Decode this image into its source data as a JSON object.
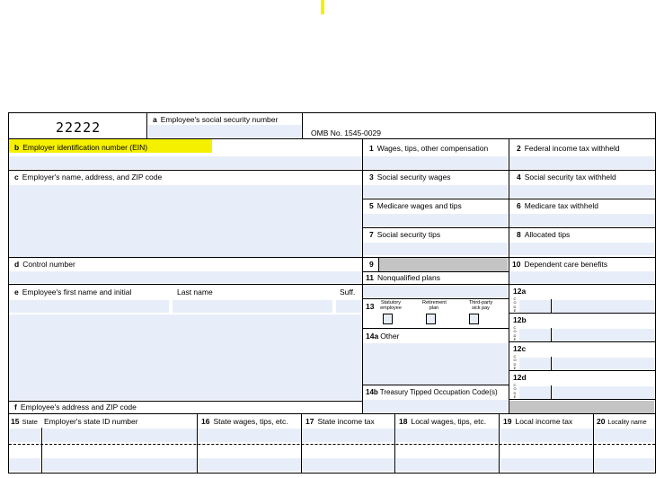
{
  "form": {
    "code": "22222",
    "omb": "OMB No. 1545-0029",
    "highlight_color": "#f5f000"
  },
  "boxes": {
    "a": {
      "letter": "a",
      "label": "Employee's social security number"
    },
    "b": {
      "letter": "b",
      "label": "Employer identification number (EIN)"
    },
    "c": {
      "letter": "c",
      "label": "Employer's name, address, and ZIP code"
    },
    "d": {
      "letter": "d",
      "label": "Control number"
    },
    "e": {
      "letter": "e",
      "label": "Employee's first name and initial",
      "last": "Last name",
      "suff": "Suff."
    },
    "f": {
      "letter": "f",
      "label": "Employee's address and ZIP code"
    },
    "b1": {
      "num": "1",
      "label": "Wages, tips, other compensation"
    },
    "b2": {
      "num": "2",
      "label": "Federal income tax withheld"
    },
    "b3": {
      "num": "3",
      "label": "Social security wages"
    },
    "b4": {
      "num": "4",
      "label": "Social security tax withheld"
    },
    "b5": {
      "num": "5",
      "label": "Medicare wages and tips"
    },
    "b6": {
      "num": "6",
      "label": "Medicare tax withheld"
    },
    "b7": {
      "num": "7",
      "label": "Social security tips"
    },
    "b8": {
      "num": "8",
      "label": "Allocated tips"
    },
    "b9": {
      "num": "9"
    },
    "b10": {
      "num": "10",
      "label": "Dependent care benefits"
    },
    "b11": {
      "num": "11",
      "label": "Nonqualified plans"
    },
    "b12a": {
      "num": "12a"
    },
    "b12b": {
      "num": "12b"
    },
    "b12c": {
      "num": "12c"
    },
    "b12d": {
      "num": "12d"
    },
    "b13": {
      "num": "13",
      "statutory": "Statutory employee",
      "retirement": "Retirement plan",
      "thirdparty": "Third-party sick pay"
    },
    "b14a": {
      "num": "14a",
      "label": "Other"
    },
    "b14b": {
      "num": "14b",
      "label": "Treasury Tipped Occupation Code(s)"
    },
    "b15": {
      "num": "15",
      "state": "State",
      "label": "Employer's state ID number"
    },
    "b16": {
      "num": "16",
      "label": "State wages, tips, etc."
    },
    "b17": {
      "num": "17",
      "label": "State income tax"
    },
    "b18": {
      "num": "18",
      "label": "Local wages, tips, etc."
    },
    "b19": {
      "num": "19",
      "label": "Local income tax"
    },
    "b20": {
      "num": "20",
      "label": "Locality name"
    }
  },
  "code_vertical": "C O D E"
}
